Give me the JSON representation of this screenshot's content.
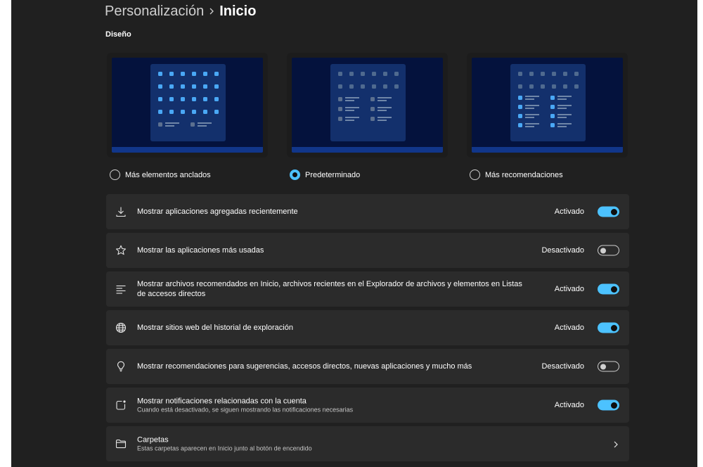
{
  "breadcrumb": {
    "parent": "Personalización",
    "current": "Inicio"
  },
  "layout_section": {
    "title": "Diseño"
  },
  "layouts": [
    {
      "label": "Más elementos anclados",
      "selected": false,
      "pinned_rows_highlighted": 4,
      "recommended_rows": 1
    },
    {
      "label": "Predeterminado",
      "selected": true,
      "pinned_rows_highlighted": 0,
      "recommended_rows": 3
    },
    {
      "label": "Más recomendaciones",
      "selected": false,
      "pinned_rows_highlighted": 0,
      "recommended_rows": 4
    }
  ],
  "settings": [
    {
      "icon": "download-icon",
      "title": "Mostrar aplicaciones agregadas recientemente",
      "state": "Activado",
      "on": true
    },
    {
      "icon": "star-icon",
      "title": "Mostrar las aplicaciones más usadas",
      "state": "Desactivado",
      "on": false
    },
    {
      "icon": "list-icon",
      "title": "Mostrar archivos recomendados en Inicio, archivos recientes en el Explorador de archivos y elementos en Listas de accesos directos",
      "state": "Activado",
      "on": true
    },
    {
      "icon": "globe-icon",
      "title": "Mostrar sitios web del historial de exploración",
      "state": "Activado",
      "on": true
    },
    {
      "icon": "lightbulb-icon",
      "title": "Mostrar recomendaciones para sugerencias, accesos directos, nuevas aplicaciones y mucho más",
      "state": "Desactivado",
      "on": false
    },
    {
      "icon": "notification-icon",
      "title": "Mostrar notificaciones relacionadas con la cuenta",
      "description": "Cuando está desactivado, se siguen mostrando las notificaciones necesarias",
      "state": "Activado",
      "on": true
    }
  ],
  "folders": {
    "icon": "folder-icon",
    "title": "Carpetas",
    "description": "Estas carpetas aparecen en Inicio junto al botón de encendido"
  },
  "colors": {
    "accent": "#4cc2ff",
    "background": "#202020",
    "card": "#2b2b2b",
    "preview_screen": "#04123d",
    "preview_startmenu": "#13306c"
  }
}
